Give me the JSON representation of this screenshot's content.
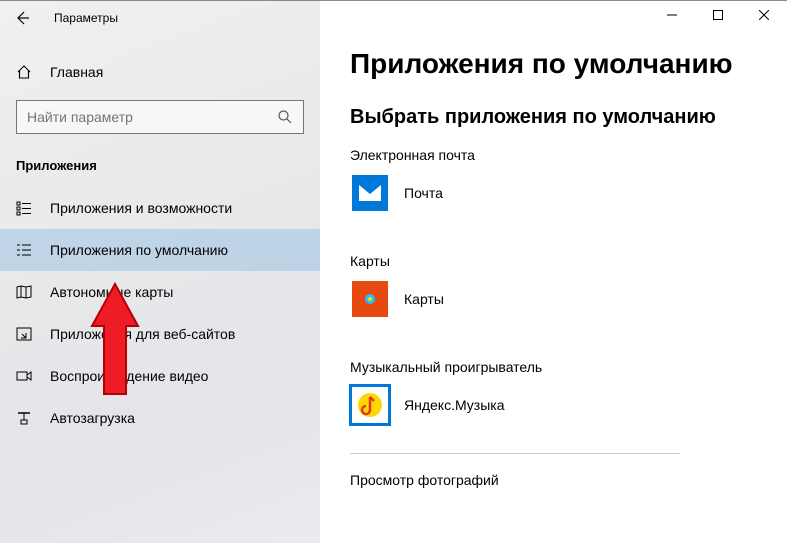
{
  "window": {
    "title": "Параметры"
  },
  "sidebar": {
    "home_label": "Главная",
    "search_placeholder": "Найти параметр",
    "section": "Приложения",
    "items": [
      {
        "label": "Приложения и возможности"
      },
      {
        "label": "Приложения по умолчанию"
      },
      {
        "label": "Автономные карты"
      },
      {
        "label": "Приложения для веб-сайтов"
      },
      {
        "label": "Воспроизведение видео"
      },
      {
        "label": "Автозагрузка"
      }
    ]
  },
  "content": {
    "title": "Приложения по умолчанию",
    "subtitle": "Выбрать приложения по умолчанию",
    "cats": {
      "email": {
        "label": "Электронная почта",
        "app": "Почта"
      },
      "maps": {
        "label": "Карты",
        "app": "Карты"
      },
      "music": {
        "label": "Музыкальный проигрыватель",
        "app": "Яндекс.Музыка"
      },
      "photo": {
        "label": "Просмотр фотографий"
      }
    }
  }
}
